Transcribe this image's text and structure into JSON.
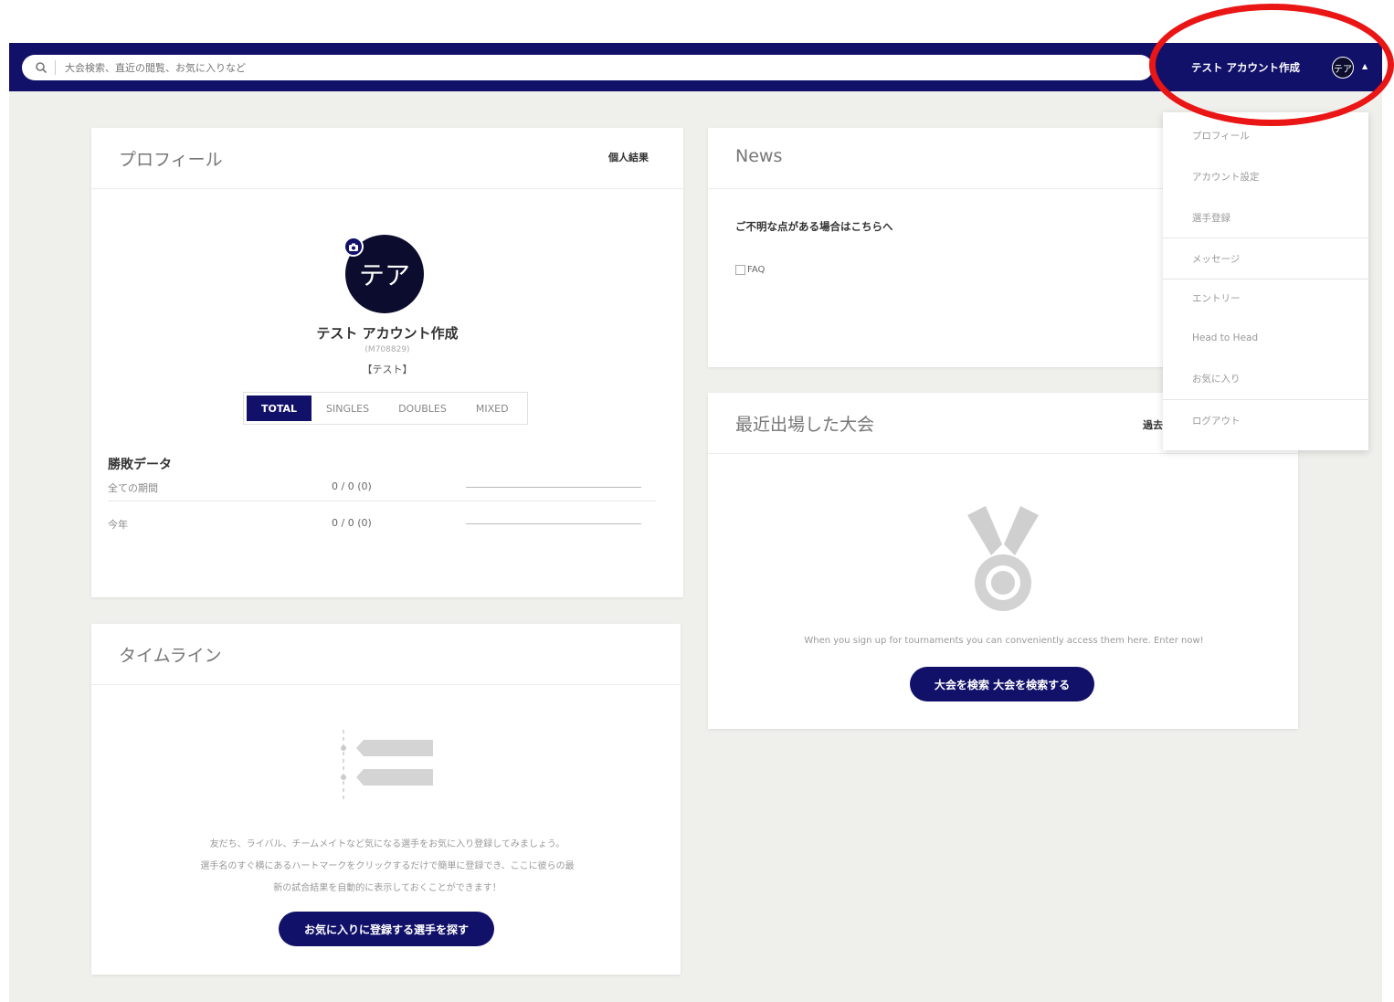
{
  "search": {
    "placeholder": "大会検索、直近の閲覧、お気に入りなど"
  },
  "header": {
    "user_name": "テスト アカウント作成",
    "avatar_initials": "テア"
  },
  "profile": {
    "title": "プロフィール",
    "link": "個人結果",
    "avatar_initials": "テア",
    "name": "テスト アカウント作成",
    "member_id": "(M708829)",
    "team": "【テスト】",
    "tabs": [
      "TOTAL",
      "SINGLES",
      "DOUBLES",
      "MIXED"
    ],
    "stats_title": "勝敗データ",
    "stats": [
      {
        "label": "全ての期間",
        "value": "0 / 0 (0)"
      },
      {
        "label": "今年",
        "value": "0 / 0 (0)"
      }
    ]
  },
  "timeline": {
    "title": "タイムライン",
    "message_lines": [
      "友だち、ライバル、チームメイトなど気になる選手をお気に入り登録してみましょう。",
      "選手名のすぐ横にあるハートマークをクリックするだけで簡単に登録でき、ここに彼らの最",
      "新の試合結果を自動的に表示しておくことができます！"
    ],
    "button": "お気に入りに登録する選手を探す"
  },
  "news": {
    "title": "News",
    "headline": "ご不明な点がある場合はこちらへ",
    "image_alt": "FAQ"
  },
  "recent": {
    "title": "最近出場した大会",
    "link": "過去",
    "message": "When you sign up for tournaments you can conveniently access them here. Enter now!",
    "button": "大会を検索 大会を検索する"
  },
  "dropdown": {
    "items": [
      "プロフィール",
      "アカウント設定",
      "選手登録",
      "メッセージ",
      "エントリー",
      "Head to Head",
      "お気に入り",
      "ログアウト"
    ]
  },
  "colors": {
    "navy": "#12116a",
    "highlight": "#ea1515",
    "background": "#efefec"
  }
}
